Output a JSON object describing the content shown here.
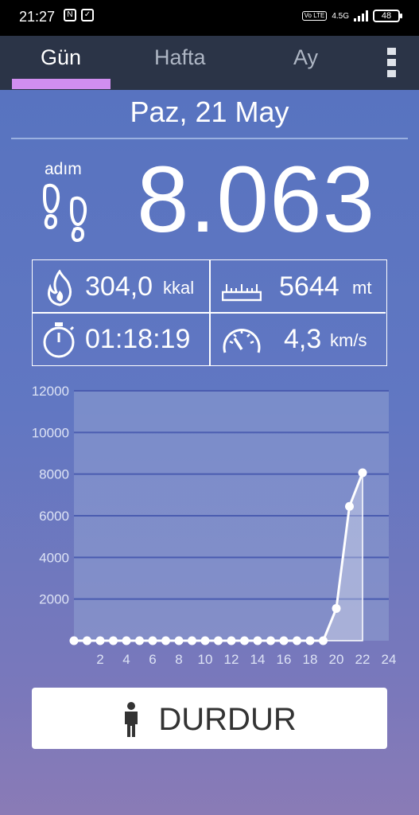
{
  "status_bar": {
    "time": "21:27",
    "network": "4.5G",
    "volte": "Vo LTE",
    "battery": "48"
  },
  "tabs": [
    {
      "label": "Gün",
      "active": true
    },
    {
      "label": "Hafta",
      "active": false
    },
    {
      "label": "Ay",
      "active": false
    }
  ],
  "date": "Paz, 21 May",
  "steps": {
    "label": "adım",
    "value": "8.063"
  },
  "stats": {
    "calories": {
      "value": "304,0",
      "unit": "kkal"
    },
    "distance": {
      "value": "5644",
      "unit": "mt"
    },
    "duration": {
      "value": "01:18:19",
      "unit": ""
    },
    "speed": {
      "value": "4,3",
      "unit": "km/s"
    }
  },
  "chart_data": {
    "type": "area",
    "x": [
      0,
      1,
      2,
      3,
      4,
      5,
      6,
      7,
      8,
      9,
      10,
      11,
      12,
      13,
      14,
      15,
      16,
      17,
      18,
      19,
      20,
      21,
      22
    ],
    "values": [
      0,
      0,
      0,
      0,
      0,
      0,
      0,
      0,
      0,
      0,
      0,
      0,
      0,
      0,
      0,
      0,
      0,
      0,
      0,
      0,
      1550,
      6450,
      8063
    ],
    "xticks": [
      "2",
      "4",
      "6",
      "8",
      "10",
      "12",
      "14",
      "16",
      "18",
      "20",
      "22",
      "24"
    ],
    "yticks": [
      "12000",
      "10000",
      "8000",
      "6000",
      "4000",
      "2000"
    ],
    "xlim": [
      0,
      24
    ],
    "ylim": [
      0,
      12000
    ],
    "grid": true,
    "colors": {
      "line": "#ffffff",
      "grid": "#4a5cb0",
      "plot_bg": "#8fa0d2"
    }
  },
  "button": {
    "label": "DURDUR"
  },
  "colors": {
    "tab_bar": "#2b3447",
    "tab_indicator": "#d18ef0",
    "background_top": "#5572bf",
    "background_bottom": "#8a7bb6"
  }
}
